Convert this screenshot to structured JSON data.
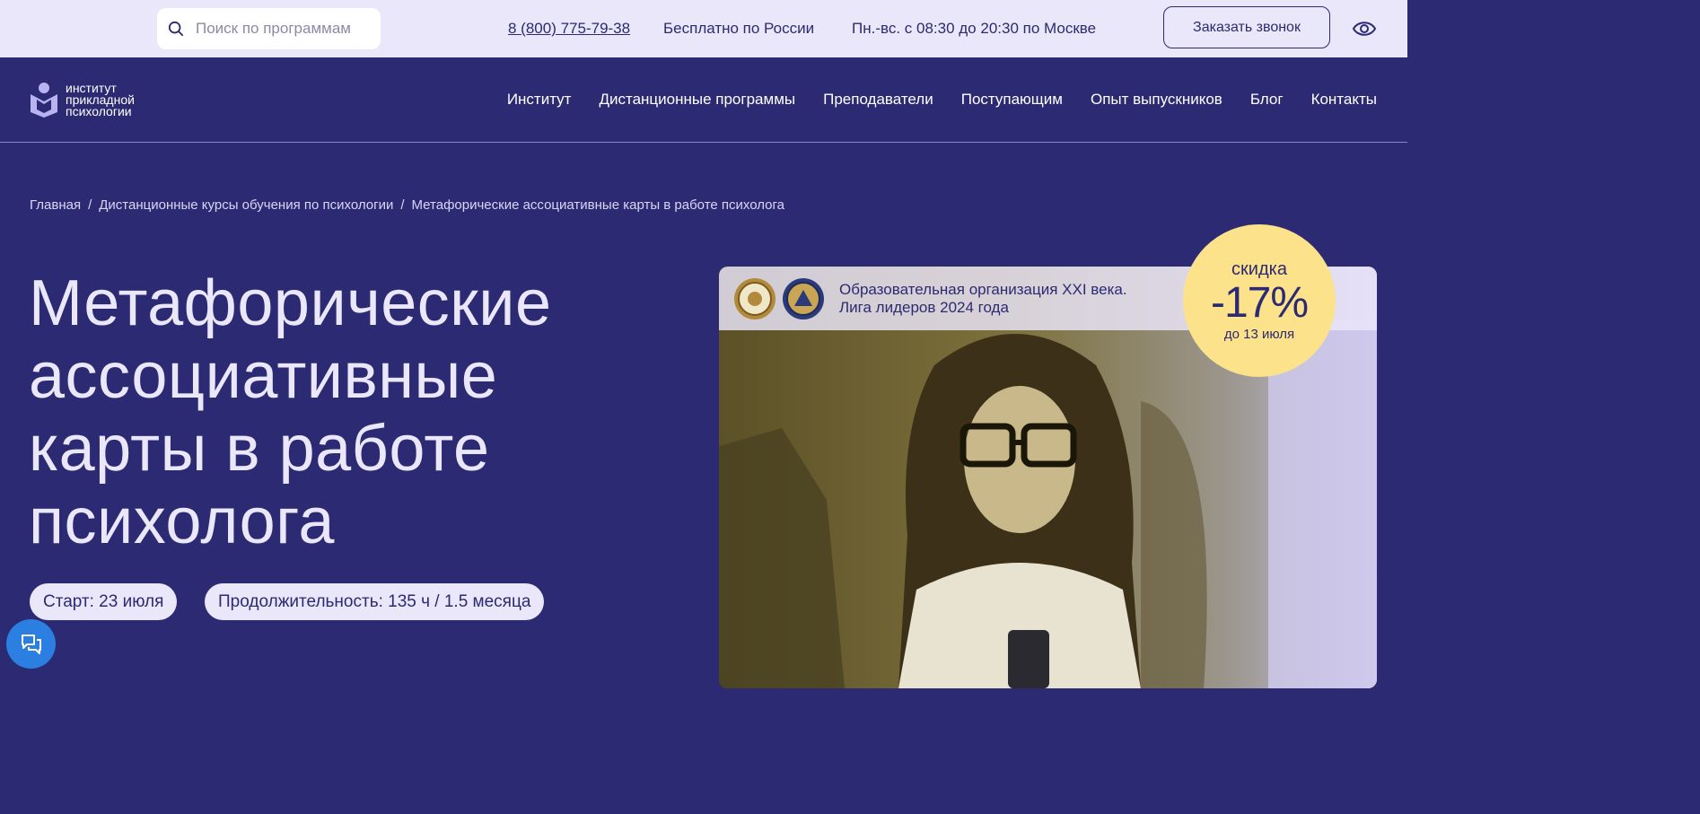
{
  "colors": {
    "brand_dark": "#2b2a72",
    "brand_light": "#ebe7fa",
    "discount_badge": "#fce28a",
    "chat_button": "#2a7fe0"
  },
  "topbar": {
    "search_placeholder": "Поиск по программам",
    "search_icon": "search-icon",
    "phone": "8 (800) 775-79-38",
    "free_call": "Бесплатно по России",
    "hours": "Пн.-вс. с 08:30 до 20:30 по Москве",
    "callback_button": "Заказать звонок",
    "accessibility_icon": "eye-icon"
  },
  "logo": {
    "line1": "институт",
    "line2": "прикладной",
    "line3": "психологии"
  },
  "nav": {
    "items": [
      {
        "label": "Институт"
      },
      {
        "label": "Дистанционные программы"
      },
      {
        "label": "Преподаватели"
      },
      {
        "label": "Поступающим"
      },
      {
        "label": "Опыт выпускников"
      },
      {
        "label": "Блог"
      },
      {
        "label": "Контакты"
      }
    ]
  },
  "breadcrumb": {
    "items": [
      {
        "label": "Главная"
      },
      {
        "label": "Дистанционные курсы обучения по психологии"
      },
      {
        "label": "Метафорические ассоциативные карты в работе психолога"
      }
    ],
    "separator": "/"
  },
  "hero": {
    "title_lines": [
      "Метафорические",
      "ассоциативные",
      "карты в работе",
      "психолога"
    ],
    "start": "Старт: 23 июля",
    "duration": "Продолжительность: 135 ч / 1.5 месяца"
  },
  "award": {
    "line1": "Образовательная организация XXI века.",
    "line2": "Лига лидеров 2024 года"
  },
  "discount": {
    "label": "скидка",
    "value": "-17%",
    "until": "до 13 июля"
  }
}
